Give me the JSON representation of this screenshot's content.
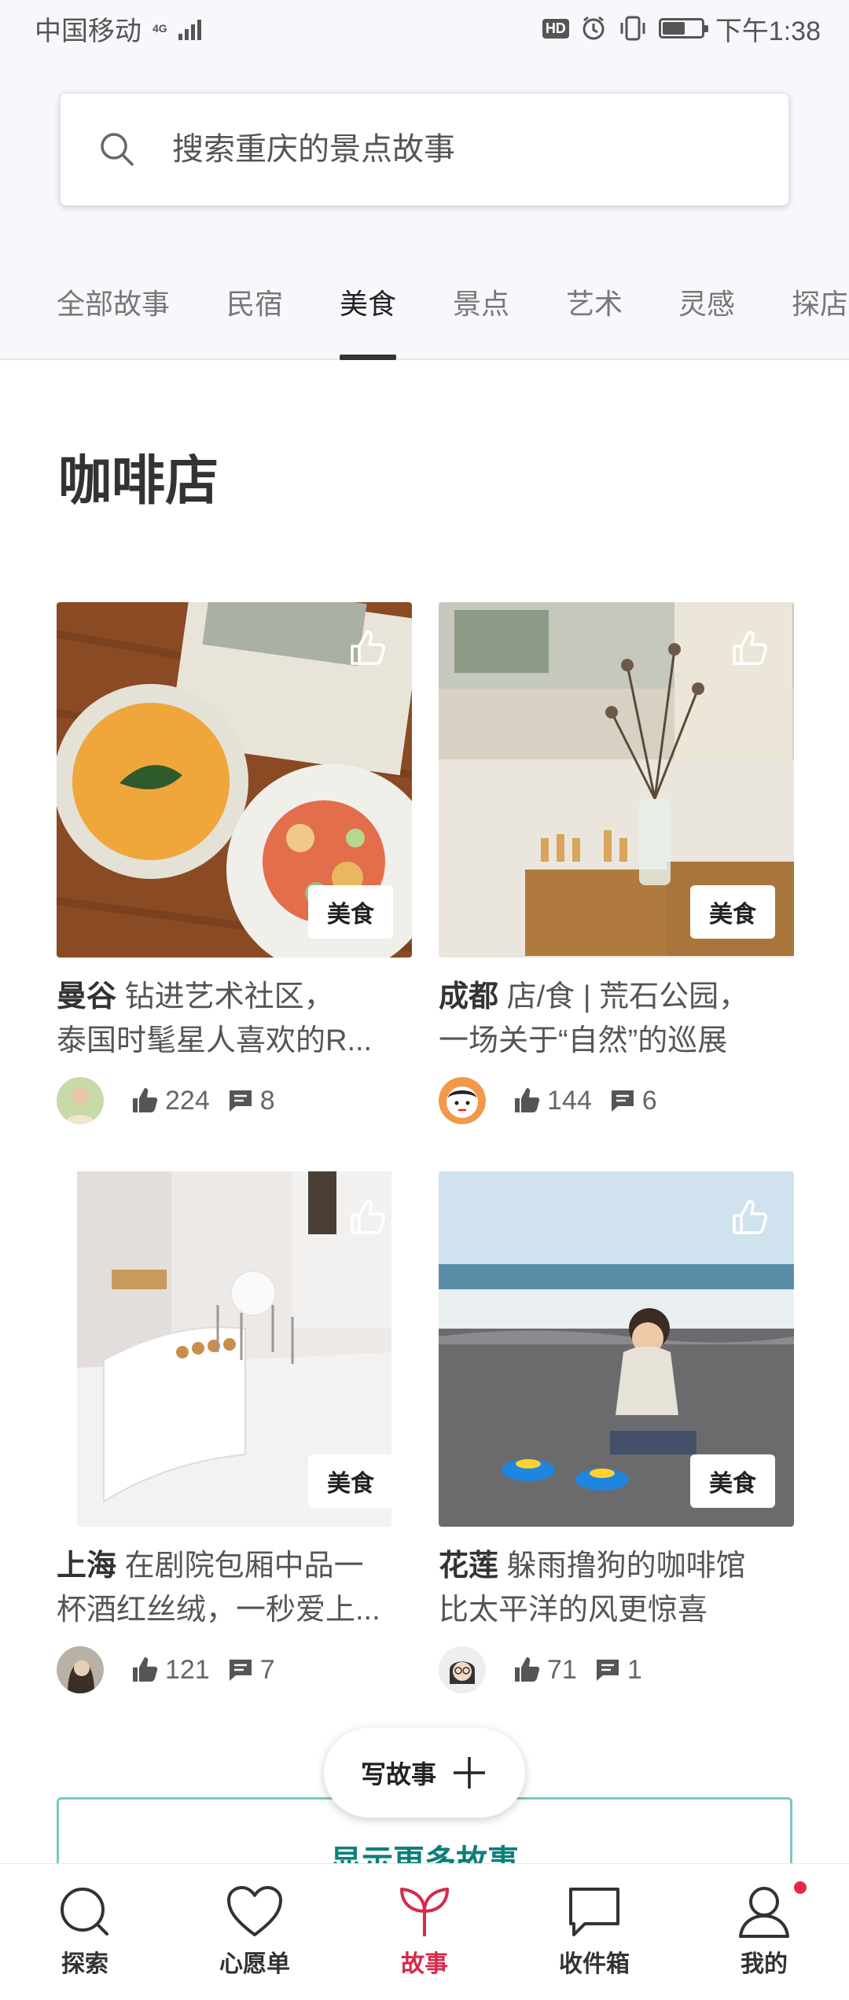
{
  "status_bar": {
    "carrier": "中国移动",
    "network": "4G",
    "hd": "HD",
    "time": "下午1:38",
    "battery_level": 0.55
  },
  "search": {
    "placeholder": "搜索重庆的景点故事",
    "icon": "search-icon"
  },
  "tabs": [
    {
      "label": "全部故事",
      "active": false
    },
    {
      "label": "民宿",
      "active": false
    },
    {
      "label": "美食",
      "active": true
    },
    {
      "label": "景点",
      "active": false
    },
    {
      "label": "艺术",
      "active": false
    },
    {
      "label": "灵感",
      "active": false
    },
    {
      "label": "探店",
      "active": false
    }
  ],
  "section_title": "咖啡店",
  "cards": [
    {
      "city": "曼谷",
      "line1": "钻进艺术社区，",
      "line2": "泰国时髦星人喜欢的R...",
      "tag": "美食",
      "likes": "224",
      "comments": "8"
    },
    {
      "city": "成都",
      "line1": "店/食 | 荒石公园，",
      "line2": "一场关于“自然”的巡展",
      "tag": "美食",
      "likes": "144",
      "comments": "6"
    },
    {
      "city": "上海",
      "line1": "在剧院包厢中品一",
      "line2": "杯酒红丝绒，一秒爱上...",
      "tag": "美食",
      "likes": "121",
      "comments": "7"
    },
    {
      "city": "花莲",
      "line1": "躲雨撸狗的咖啡馆",
      "line2": "比太平洋的风更惊喜",
      "tag": "美食",
      "likes": "71",
      "comments": "1"
    }
  ],
  "write_button": "写故事",
  "more_button": "显示更多故事",
  "bottom_nav": [
    {
      "label": "探索",
      "icon": "search-icon",
      "active": false
    },
    {
      "label": "心愿单",
      "icon": "heart-icon",
      "active": false
    },
    {
      "label": "故事",
      "icon": "sprout-icon",
      "active": true
    },
    {
      "label": "收件箱",
      "icon": "chat-bubble-icon",
      "active": false
    },
    {
      "label": "我的",
      "icon": "profile-icon",
      "active": false
    }
  ],
  "colors": {
    "accent": "#d52a4a",
    "teal": "#0c7f7a",
    "background": "#f7f8fb"
  }
}
